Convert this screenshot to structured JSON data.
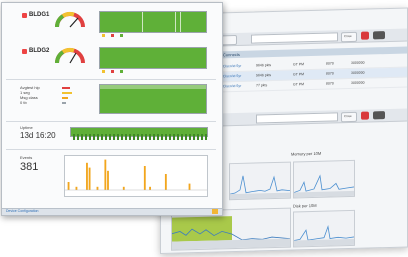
{
  "front_panel": {
    "buildings": [
      {
        "label": "BLDG1",
        "legend": [
          "",
          "",
          ""
        ]
      },
      {
        "label": "BLDG2",
        "legend": [
          "",
          "",
          ""
        ]
      }
    ],
    "metrics_labels": [
      "Avgtest hip",
      "1 seg",
      "Msg class",
      "0 tb"
    ],
    "uptime": {
      "label": "Uptime",
      "value": "13d 16:20"
    },
    "events": {
      "label": "Events",
      "value": "381"
    },
    "status_bar": "Device Configuration",
    "event_bars": [
      0.0,
      0.25,
      0.0,
      0.0,
      0.1,
      0.0,
      0.0,
      0.0,
      0.85,
      0.7,
      0.0,
      0.0,
      0.1,
      0.0,
      0.0,
      0.95,
      0.6,
      0.0,
      0.0,
      0.0,
      0.0,
      0.0,
      0.1,
      0.0,
      0.0,
      0.0,
      0.0,
      0.0,
      0.0,
      0.0,
      0.75,
      0.0,
      0.1,
      0.0,
      0.0,
      0.0,
      0.0,
      0.0,
      0.5,
      0.0,
      0.0,
      0.0,
      0.0,
      0.0,
      0.0,
      0.0,
      0.0,
      0.2,
      0.0,
      0.0,
      0.0,
      0.0,
      0.0,
      0.0
    ]
  },
  "back_window": {
    "section_title": "Connects",
    "rows": [
      {
        "name": "Cisco/xt 5yr",
        "a": "9646 pkts",
        "b": "GT PM",
        "c": "8070",
        "d": "3000000"
      },
      {
        "name": "Cisco/xt 5yr",
        "a": "5646 pkts",
        "b": "GT PM",
        "c": "8070",
        "d": "3000000"
      },
      {
        "name": "Cisco/xt 5yr",
        "a": "77 pkts",
        "b": "GT PM",
        "c": "8070",
        "d": "3000000"
      }
    ],
    "charts": [
      {
        "title": ""
      },
      {
        "title": "Memory per 10M"
      },
      {
        "title": ""
      },
      {
        "title": "Disk per 10M"
      }
    ],
    "button_labels": [
      "Close",
      "Close"
    ]
  },
  "colors": {
    "accent_green": "#5fb038",
    "bar_orange": "#f2a61d",
    "link_blue": "#2f6fb5",
    "alert_red": "#e44444"
  }
}
